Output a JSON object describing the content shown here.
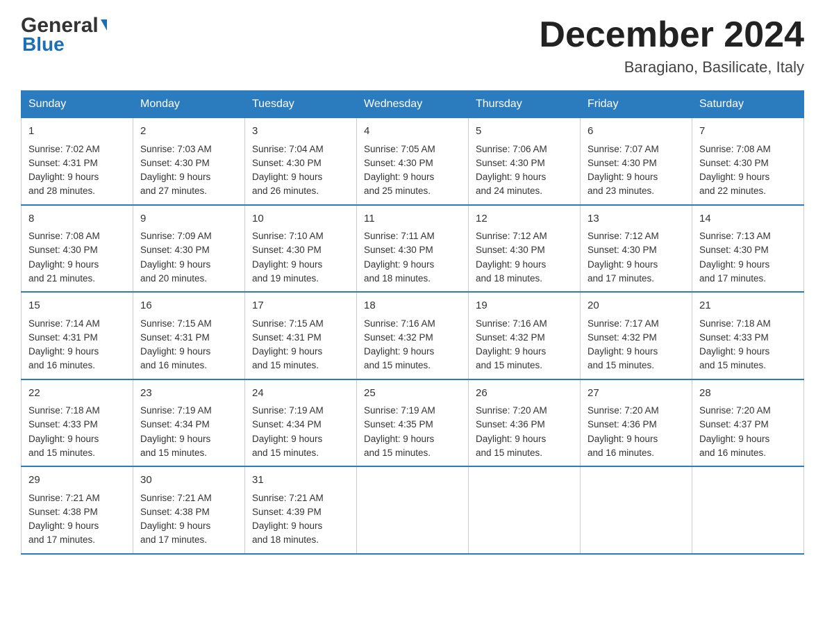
{
  "header": {
    "logo_main": "General",
    "logo_triangle": "▼",
    "logo_blue": "Blue",
    "title": "December 2024",
    "subtitle": "Baragiano, Basilicate, Italy"
  },
  "days_of_week": [
    "Sunday",
    "Monday",
    "Tuesday",
    "Wednesday",
    "Thursday",
    "Friday",
    "Saturday"
  ],
  "weeks": [
    [
      {
        "num": "1",
        "sunrise": "7:02 AM",
        "sunset": "4:31 PM",
        "daylight": "9 hours and 28 minutes."
      },
      {
        "num": "2",
        "sunrise": "7:03 AM",
        "sunset": "4:30 PM",
        "daylight": "9 hours and 27 minutes."
      },
      {
        "num": "3",
        "sunrise": "7:04 AM",
        "sunset": "4:30 PM",
        "daylight": "9 hours and 26 minutes."
      },
      {
        "num": "4",
        "sunrise": "7:05 AM",
        "sunset": "4:30 PM",
        "daylight": "9 hours and 25 minutes."
      },
      {
        "num": "5",
        "sunrise": "7:06 AM",
        "sunset": "4:30 PM",
        "daylight": "9 hours and 24 minutes."
      },
      {
        "num": "6",
        "sunrise": "7:07 AM",
        "sunset": "4:30 PM",
        "daylight": "9 hours and 23 minutes."
      },
      {
        "num": "7",
        "sunrise": "7:08 AM",
        "sunset": "4:30 PM",
        "daylight": "9 hours and 22 minutes."
      }
    ],
    [
      {
        "num": "8",
        "sunrise": "7:08 AM",
        "sunset": "4:30 PM",
        "daylight": "9 hours and 21 minutes."
      },
      {
        "num": "9",
        "sunrise": "7:09 AM",
        "sunset": "4:30 PM",
        "daylight": "9 hours and 20 minutes."
      },
      {
        "num": "10",
        "sunrise": "7:10 AM",
        "sunset": "4:30 PM",
        "daylight": "9 hours and 19 minutes."
      },
      {
        "num": "11",
        "sunrise": "7:11 AM",
        "sunset": "4:30 PM",
        "daylight": "9 hours and 18 minutes."
      },
      {
        "num": "12",
        "sunrise": "7:12 AM",
        "sunset": "4:30 PM",
        "daylight": "9 hours and 18 minutes."
      },
      {
        "num": "13",
        "sunrise": "7:12 AM",
        "sunset": "4:30 PM",
        "daylight": "9 hours and 17 minutes."
      },
      {
        "num": "14",
        "sunrise": "7:13 AM",
        "sunset": "4:30 PM",
        "daylight": "9 hours and 17 minutes."
      }
    ],
    [
      {
        "num": "15",
        "sunrise": "7:14 AM",
        "sunset": "4:31 PM",
        "daylight": "9 hours and 16 minutes."
      },
      {
        "num": "16",
        "sunrise": "7:15 AM",
        "sunset": "4:31 PM",
        "daylight": "9 hours and 16 minutes."
      },
      {
        "num": "17",
        "sunrise": "7:15 AM",
        "sunset": "4:31 PM",
        "daylight": "9 hours and 15 minutes."
      },
      {
        "num": "18",
        "sunrise": "7:16 AM",
        "sunset": "4:32 PM",
        "daylight": "9 hours and 15 minutes."
      },
      {
        "num": "19",
        "sunrise": "7:16 AM",
        "sunset": "4:32 PM",
        "daylight": "9 hours and 15 minutes."
      },
      {
        "num": "20",
        "sunrise": "7:17 AM",
        "sunset": "4:32 PM",
        "daylight": "9 hours and 15 minutes."
      },
      {
        "num": "21",
        "sunrise": "7:18 AM",
        "sunset": "4:33 PM",
        "daylight": "9 hours and 15 minutes."
      }
    ],
    [
      {
        "num": "22",
        "sunrise": "7:18 AM",
        "sunset": "4:33 PM",
        "daylight": "9 hours and 15 minutes."
      },
      {
        "num": "23",
        "sunrise": "7:19 AM",
        "sunset": "4:34 PM",
        "daylight": "9 hours and 15 minutes."
      },
      {
        "num": "24",
        "sunrise": "7:19 AM",
        "sunset": "4:34 PM",
        "daylight": "9 hours and 15 minutes."
      },
      {
        "num": "25",
        "sunrise": "7:19 AM",
        "sunset": "4:35 PM",
        "daylight": "9 hours and 15 minutes."
      },
      {
        "num": "26",
        "sunrise": "7:20 AM",
        "sunset": "4:36 PM",
        "daylight": "9 hours and 15 minutes."
      },
      {
        "num": "27",
        "sunrise": "7:20 AM",
        "sunset": "4:36 PM",
        "daylight": "9 hours and 16 minutes."
      },
      {
        "num": "28",
        "sunrise": "7:20 AM",
        "sunset": "4:37 PM",
        "daylight": "9 hours and 16 minutes."
      }
    ],
    [
      {
        "num": "29",
        "sunrise": "7:21 AM",
        "sunset": "4:38 PM",
        "daylight": "9 hours and 17 minutes."
      },
      {
        "num": "30",
        "sunrise": "7:21 AM",
        "sunset": "4:38 PM",
        "daylight": "9 hours and 17 minutes."
      },
      {
        "num": "31",
        "sunrise": "7:21 AM",
        "sunset": "4:39 PM",
        "daylight": "9 hours and 18 minutes."
      },
      null,
      null,
      null,
      null
    ]
  ]
}
